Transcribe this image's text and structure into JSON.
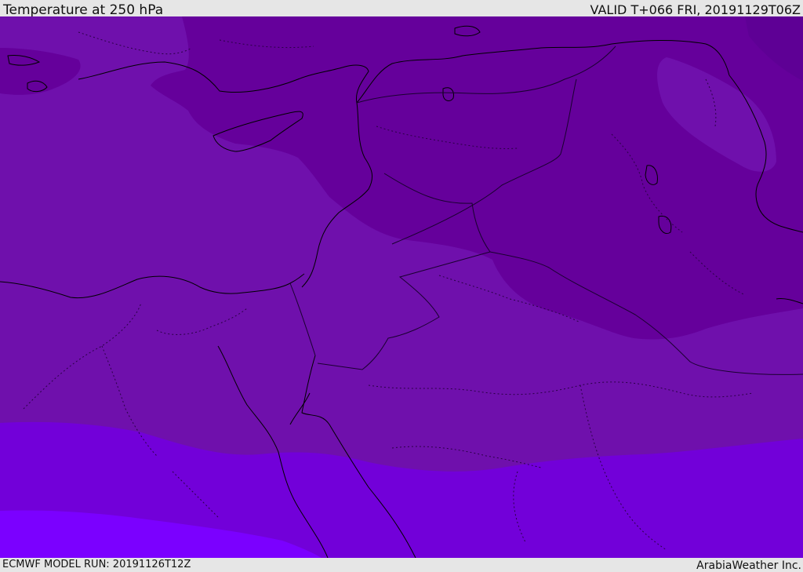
{
  "header": {
    "title": "Temperature at 250 hPa",
    "valid_time": "VALID T+066 FRI, 20191129T06Z"
  },
  "footer": {
    "model_run": "ECMWF MODEL RUN: 20191126T12Z",
    "credit": "ArabiaWeather Inc."
  },
  "map": {
    "colors": {
      "band_coldest": "#5e0095",
      "band_cold": "#65009b",
      "band_mid": "#6f10ac",
      "band_warm": "#7200d9",
      "band_warmest": "#7b00ff",
      "coast_line": "#000000",
      "border_line": "#1a0030"
    }
  }
}
